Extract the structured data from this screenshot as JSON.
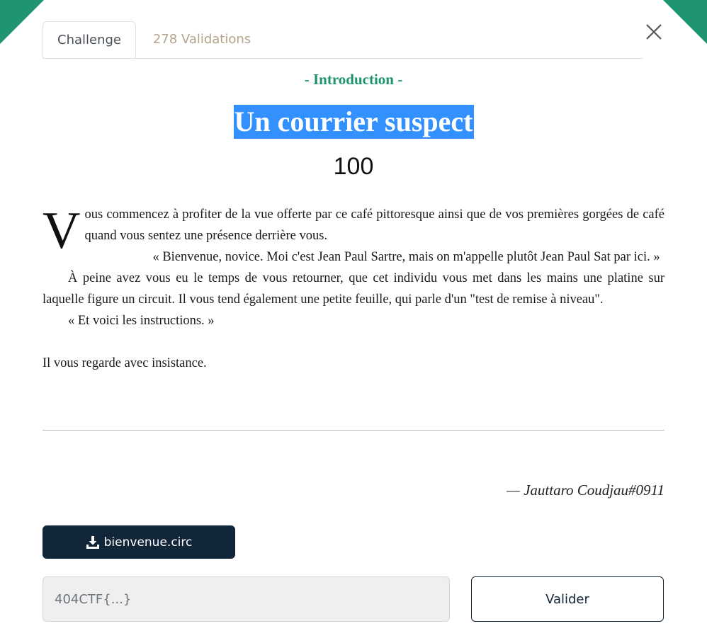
{
  "tabs": [
    {
      "label": "Challenge",
      "active": true
    },
    {
      "label": "278 Validations",
      "active": false
    }
  ],
  "challenge": {
    "category": "- Introduction -",
    "title": "Un courrier suspect",
    "points": "100",
    "description": {
      "dropcap": "V",
      "p1": "ous commencez à profiter de la vue offerte par ce café pittoresque ainsi que de vos premières gorgées de café quand vous sentez une présence derrière vous.",
      "p2": "« Bienvenue, novice. Moi c'est Jean Paul Sartre, mais on m'appelle plutôt Jean Paul Sat par ici. »",
      "p3": "À peine avez vous eu le temps de vous retourner, que cet individu vous met dans les mains une platine sur laquelle figure un circuit. Il vous tend également une petite feuille, qui parle d'un \"test de remise à niveau\".",
      "p4": "« Et voici les instructions. »",
      "p5": "Il vous regarde avec insistance."
    },
    "author": "— Jauttaro Coudjau#0911",
    "file": {
      "name": "bienvenue.circ",
      "icon": "download-icon"
    }
  },
  "flag": {
    "placeholder": "404CTF{...}",
    "value": ""
  },
  "submit_label": "Valider",
  "colors": {
    "accent": "#1f9470",
    "primary": "#12263a",
    "title_highlight": "#3390ff",
    "inactive_tab": "#b5a38c"
  }
}
